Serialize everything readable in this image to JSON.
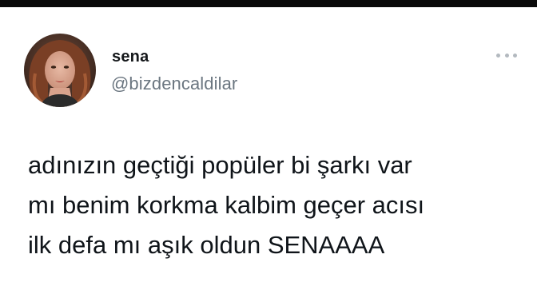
{
  "user": {
    "display_name": "sena",
    "handle": "@bizdencaldilar",
    "avatar_icon": "profile-photo"
  },
  "menu": {
    "icon": "more-dots-icon"
  },
  "tweet": {
    "lines": [
      "adınızın geçtiği popüler bi şarkı var",
      "mı benim korkma kalbim geçer acısı",
      "ilk defa mı aşık oldun SENAAAA"
    ]
  },
  "colors": {
    "top_bar": "#0a0a0a",
    "text": "#0f1419",
    "handle": "#6b7680",
    "menu_dots": "#b3b9bf"
  }
}
